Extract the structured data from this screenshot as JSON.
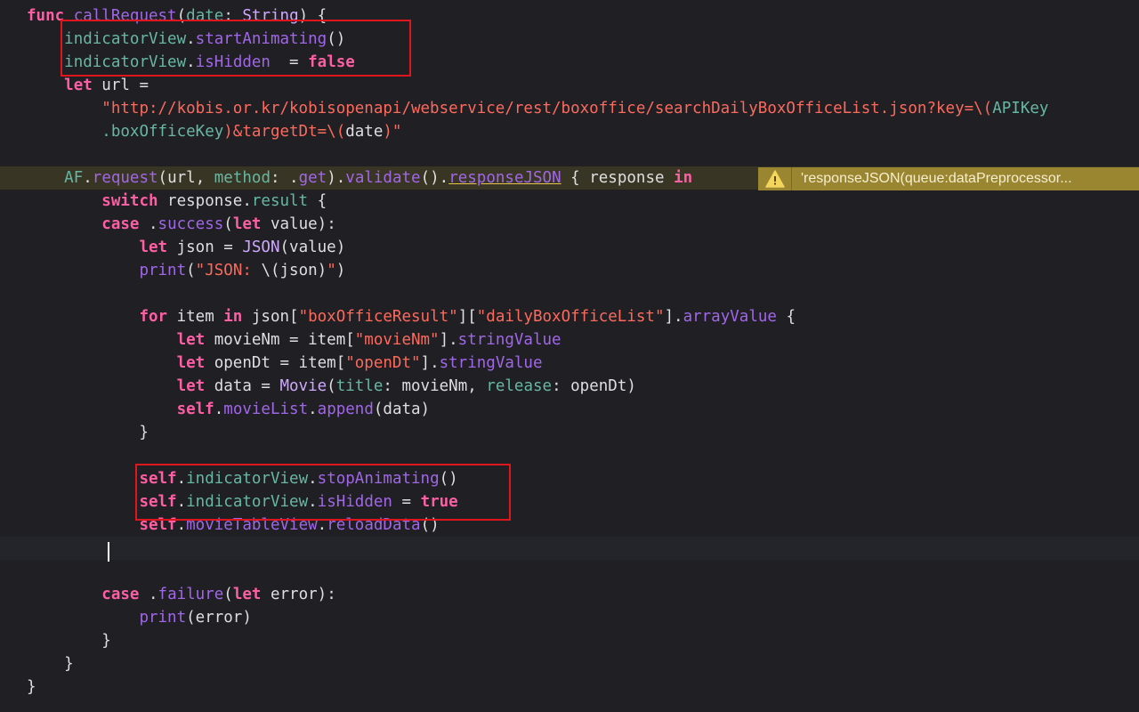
{
  "code": {
    "lines": [
      [
        [
          "kw",
          "func"
        ],
        [
          "t",
          " "
        ],
        [
          "fn",
          "callRequest"
        ],
        [
          "t",
          "("
        ],
        [
          "prop",
          "date"
        ],
        [
          "t",
          ": "
        ],
        [
          "type",
          "String"
        ],
        [
          "t",
          ") {"
        ]
      ],
      [
        [
          "t",
          "    "
        ],
        [
          "prop",
          "indicatorView"
        ],
        [
          "t",
          "."
        ],
        [
          "fn",
          "startAnimating"
        ],
        [
          "t",
          "()"
        ]
      ],
      [
        [
          "t",
          "    "
        ],
        [
          "prop",
          "indicatorView"
        ],
        [
          "t",
          "."
        ],
        [
          "fn",
          "isHidden"
        ],
        [
          "t",
          "  = "
        ],
        [
          "kw",
          "false"
        ]
      ],
      [
        [
          "t",
          "    "
        ],
        [
          "kw",
          "let"
        ],
        [
          "t",
          " url ="
        ]
      ],
      [
        [
          "t",
          "        "
        ],
        [
          "str",
          "\"http://kobis.or.kr/kobisopenapi/webservice/rest/boxoffice/searchDailyBoxOfficeList.json?key=\\("
        ],
        [
          "prop",
          "APIKey"
        ]
      ],
      [
        [
          "t",
          "        "
        ],
        [
          "prop",
          ".boxOfficeKey"
        ],
        [
          "str",
          ")&targetDt=\\("
        ],
        [
          "t",
          "date"
        ],
        [
          "str",
          ")\""
        ]
      ],
      [
        [
          "t",
          ""
        ]
      ],
      [
        [
          "t",
          "    "
        ],
        [
          "prop",
          "AF"
        ],
        [
          "t",
          "."
        ],
        [
          "fn",
          "request"
        ],
        [
          "t",
          "(url, "
        ],
        [
          "prop",
          "method"
        ],
        [
          "t",
          ": ."
        ],
        [
          "fn",
          "get"
        ],
        [
          "t",
          ")."
        ],
        [
          "fn",
          "validate"
        ],
        [
          "t",
          "()."
        ],
        [
          "warnfn",
          "responseJSON"
        ],
        [
          "t",
          " { response "
        ],
        [
          "kw",
          "in"
        ]
      ],
      [
        [
          "t",
          "        "
        ],
        [
          "kw",
          "switch"
        ],
        [
          "t",
          " response."
        ],
        [
          "prop",
          "result"
        ],
        [
          "t",
          " {"
        ]
      ],
      [
        [
          "t",
          "        "
        ],
        [
          "kw",
          "case"
        ],
        [
          "t",
          " ."
        ],
        [
          "fn",
          "success"
        ],
        [
          "t",
          "("
        ],
        [
          "kw",
          "let"
        ],
        [
          "t",
          " value):"
        ]
      ],
      [
        [
          "t",
          "            "
        ],
        [
          "kw",
          "let"
        ],
        [
          "t",
          " json = "
        ],
        [
          "type",
          "JSON"
        ],
        [
          "t",
          "(value)"
        ]
      ],
      [
        [
          "t",
          "            "
        ],
        [
          "fn",
          "print"
        ],
        [
          "t",
          "("
        ],
        [
          "str",
          "\"JSON: "
        ],
        [
          "t",
          "\\(json)"
        ],
        [
          "str",
          "\""
        ],
        [
          "t",
          ")"
        ]
      ],
      [
        [
          "t",
          ""
        ]
      ],
      [
        [
          "t",
          "            "
        ],
        [
          "kw",
          "for"
        ],
        [
          "t",
          " item "
        ],
        [
          "kw",
          "in"
        ],
        [
          "t",
          " json["
        ],
        [
          "str",
          "\"boxOfficeResult\""
        ],
        [
          "t",
          "]["
        ],
        [
          "str",
          "\"dailyBoxOfficeList\""
        ],
        [
          "t",
          "]."
        ],
        [
          "fn",
          "arrayValue"
        ],
        [
          "t",
          " {"
        ]
      ],
      [
        [
          "t",
          "                "
        ],
        [
          "kw",
          "let"
        ],
        [
          "t",
          " movieNm = item["
        ],
        [
          "str",
          "\"movieNm\""
        ],
        [
          "t",
          "]."
        ],
        [
          "fn",
          "stringValue"
        ]
      ],
      [
        [
          "t",
          "                "
        ],
        [
          "kw",
          "let"
        ],
        [
          "t",
          " openDt = item["
        ],
        [
          "str",
          "\"openDt\""
        ],
        [
          "t",
          "]."
        ],
        [
          "fn",
          "stringValue"
        ]
      ],
      [
        [
          "t",
          "                "
        ],
        [
          "kw",
          "let"
        ],
        [
          "t",
          " data = "
        ],
        [
          "type",
          "Movie"
        ],
        [
          "t",
          "("
        ],
        [
          "prop",
          "title"
        ],
        [
          "t",
          ": movieNm, "
        ],
        [
          "prop",
          "release"
        ],
        [
          "t",
          ": openDt)"
        ]
      ],
      [
        [
          "t",
          "                "
        ],
        [
          "kw",
          "self"
        ],
        [
          "t",
          "."
        ],
        [
          "fn",
          "movieList"
        ],
        [
          "t",
          "."
        ],
        [
          "fn",
          "append"
        ],
        [
          "t",
          "(data)"
        ]
      ],
      [
        [
          "t",
          "            }"
        ]
      ],
      [
        [
          "t",
          ""
        ]
      ],
      [
        [
          "t",
          "            "
        ],
        [
          "kw",
          "self"
        ],
        [
          "t",
          "."
        ],
        [
          "prop",
          "indicatorView"
        ],
        [
          "t",
          "."
        ],
        [
          "fn",
          "stopAnimating"
        ],
        [
          "t",
          "()"
        ]
      ],
      [
        [
          "t",
          "            "
        ],
        [
          "kw",
          "self"
        ],
        [
          "t",
          "."
        ],
        [
          "prop",
          "indicatorView"
        ],
        [
          "t",
          "."
        ],
        [
          "fn",
          "isHidden"
        ],
        [
          "t",
          " = "
        ],
        [
          "kw",
          "true"
        ]
      ],
      [
        [
          "t",
          "            "
        ],
        [
          "kw",
          "self"
        ],
        [
          "t",
          "."
        ],
        [
          "fn",
          "movieTableView"
        ],
        [
          "t",
          "."
        ],
        [
          "fn",
          "reloadData"
        ],
        [
          "t",
          "()"
        ]
      ],
      [
        [
          "t",
          ""
        ]
      ],
      [
        [
          "t",
          ""
        ]
      ],
      [
        [
          "t",
          "        "
        ],
        [
          "kw",
          "case"
        ],
        [
          "t",
          " ."
        ],
        [
          "fn",
          "failure"
        ],
        [
          "t",
          "("
        ],
        [
          "kw",
          "let"
        ],
        [
          "t",
          " error):"
        ]
      ],
      [
        [
          "t",
          "            "
        ],
        [
          "fn",
          "print"
        ],
        [
          "t",
          "(error)"
        ]
      ],
      [
        [
          "t",
          "        }"
        ]
      ],
      [
        [
          "t",
          "    }"
        ]
      ],
      [
        [
          "t",
          "}"
        ]
      ]
    ],
    "warning_line": 7,
    "current_line": 23
  },
  "warning": {
    "icon": "warning-triangle-icon",
    "message": "'responseJSON(queue:dataPreprocessor..."
  },
  "colors": {
    "background": "#1f1f24",
    "keyword": "#fc5fa3",
    "string": "#fc6a5d",
    "function": "#a167e6",
    "property": "#67b7a4",
    "plain": "#dfdfe0",
    "highlight_box": "#e0161f",
    "warning_bar": "#9a8530"
  }
}
